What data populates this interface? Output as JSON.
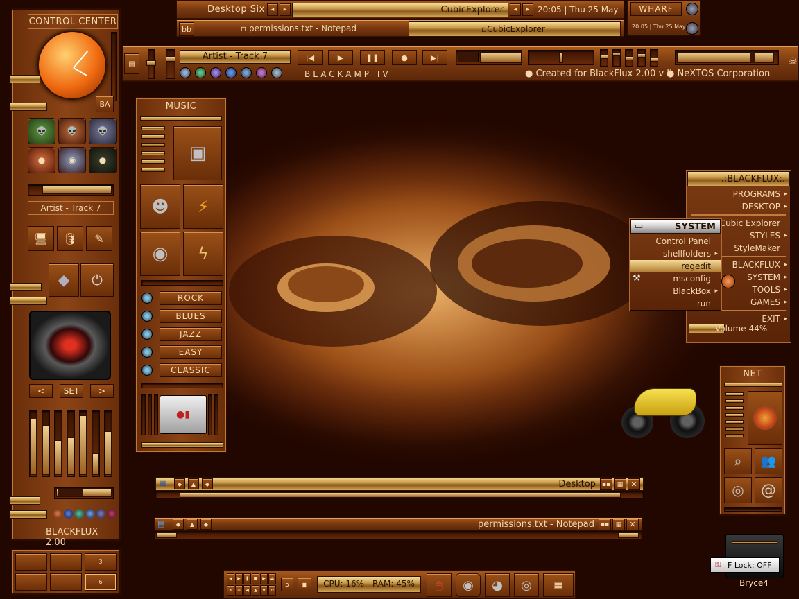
{
  "top": {
    "workspace_label": "Desktop Six",
    "active_window_title": "CubicExplorer",
    "clock": "20:05 | Thu 25 May",
    "tray_btn": "bb",
    "tasks": [
      "permissions.txt - Notepad",
      "CubicExplorer"
    ],
    "wharf_label": "WHARF",
    "wharf_clock": "20:05 | Thu 25 May"
  },
  "blackamp": {
    "track": "Artist - Track 7",
    "name": "BLACKAMP IV",
    "credit1": "Created for BlackFlux 2.00 v II",
    "credit2": "NeXTOS Corporation"
  },
  "control_center": {
    "title": "CONTROL CENTER",
    "ba_button": "BA",
    "track": "Artist - Track 7",
    "prev": "<",
    "set": "SET",
    "next": ">",
    "footer": "BLACKFLUX 2.00",
    "equalizer_levels": [
      0.9,
      0.8,
      0.55,
      0.6,
      0.95,
      0.35,
      0.7
    ],
    "pager": [
      "",
      "",
      "3",
      "",
      "",
      "6"
    ]
  },
  "music": {
    "title": "MUSIC",
    "genres": [
      "ROCK",
      "BLUES",
      "JAZZ",
      "EASY",
      "CLASSIC"
    ]
  },
  "blackflux_menu": {
    "title": ".:BLACKFLUX:.",
    "items": [
      {
        "label": "PROGRAMS",
        "arrow": true
      },
      {
        "label": "DESKTOP",
        "arrow": true
      },
      {
        "label": "Cubic Explorer",
        "arrow": false
      },
      {
        "label": "STYLES",
        "arrow": true
      },
      {
        "label": "StyleMaker",
        "arrow": false
      },
      {
        "label": "BLACKFLUX",
        "arrow": true
      },
      {
        "label": "SYSTEM",
        "arrow": true
      },
      {
        "label": "TOOLS",
        "arrow": true
      },
      {
        "label": "GAMES",
        "arrow": true
      },
      {
        "label": "EXIT",
        "arrow": true
      }
    ],
    "volume": "Volume 44%"
  },
  "system_menu": {
    "title": "SYSTEM",
    "items": [
      {
        "label": "Control Panel",
        "arrow": false
      },
      {
        "label": "shellfolders",
        "arrow": true
      },
      {
        "label": "regedit",
        "arrow": false,
        "selected": true
      },
      {
        "label": "msconfig",
        "arrow": false
      },
      {
        "label": "BlackBox",
        "arrow": true
      },
      {
        "label": "run",
        "arrow": false
      }
    ]
  },
  "windows": [
    {
      "title": "Desktop"
    },
    {
      "title": "permissions.txt - Notepad"
    }
  ],
  "net": {
    "title": "NET"
  },
  "taskbar": {
    "desk_num": "5",
    "stats": "CPU: 16% - RAM: 45%"
  },
  "flock": {
    "label": "F Lock: OFF",
    "caption": "Bryce4"
  },
  "colors": {
    "accent": "#c27a3a",
    "gold": "#e8c47a",
    "dark": "#2a0c00"
  }
}
